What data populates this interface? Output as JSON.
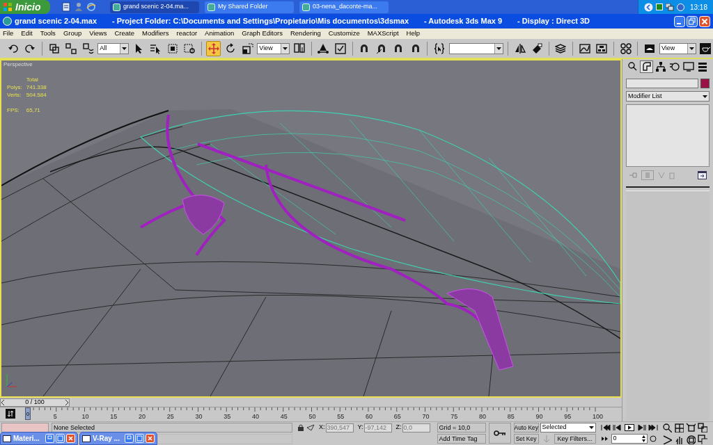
{
  "taskbar": {
    "start": "Inicio",
    "tasks": [
      {
        "label": "grand scenic 2-04.ma...",
        "selected": true
      },
      {
        "label": "My Shared Folder",
        "selected": false
      },
      {
        "label": "03-nena_daconte-ma...",
        "selected": false
      }
    ],
    "clock": "13:18"
  },
  "window": {
    "title_parts": [
      "grand scenic 2-04.max",
      "- Project Folder: C:\\Documents and Settings\\Propietario\\Mis documentos\\3dsmax",
      "- Autodesk 3ds Max 9",
      "- Display : Direct 3D"
    ]
  },
  "menu": [
    "File",
    "Edit",
    "Tools",
    "Group",
    "Views",
    "Create",
    "Modifiers",
    "reactor",
    "Animation",
    "Graph Editors",
    "Rendering",
    "Customize",
    "MAXScript",
    "Help"
  ],
  "toolbar": {
    "selection_filter": "All",
    "reference_coordinate_system": "View",
    "render_view": "View",
    "mode_tools": [
      {
        "selected": false
      },
      {
        "selected": true
      },
      {
        "selected": false
      },
      {
        "selected": false
      }
    ]
  },
  "viewport": {
    "label": "Perspective",
    "stats_header": "Total",
    "stats": [
      {
        "label": "Polys:",
        "value": "741.338"
      },
      {
        "label": "Verts:",
        "value": "504.584"
      }
    ],
    "fps_label": "FPS:",
    "fps": "65,71"
  },
  "command_panel": {
    "tabs": [
      {
        "selected": false
      },
      {
        "selected": true
      },
      {
        "selected": false
      },
      {
        "selected": false
      },
      {
        "selected": false
      },
      {
        "selected": false
      }
    ],
    "modifier_list": "Modifier List"
  },
  "time_slider": {
    "label": "0 / 100",
    "level": 0
  },
  "track_bar": {
    "labels": [
      "0",
      "5",
      "10",
      "15",
      "20",
      "25",
      "30",
      "35",
      "40",
      "45",
      "50",
      "55",
      "60",
      "65",
      "70",
      "75",
      "80",
      "85",
      "90",
      "95",
      "100"
    ]
  },
  "status_bar": {
    "prompt": "None Selected",
    "coordinates": [
      {
        "axis": "X:",
        "value": "390,547"
      },
      {
        "axis": "Y:",
        "value": "-97,142"
      },
      {
        "axis": "Z:",
        "value": "0,0"
      }
    ],
    "grid": "Grid = 10,0",
    "add_time_tag": "Add Time Tag",
    "auto_key": "Auto Key",
    "set_key": "Set Key",
    "key_target": "Selected",
    "key_filters": "Key Filters...",
    "frame": "0"
  },
  "minimized_windows": [
    {
      "title": "Materi..."
    },
    {
      "title": "V-Ray ..."
    }
  ]
}
